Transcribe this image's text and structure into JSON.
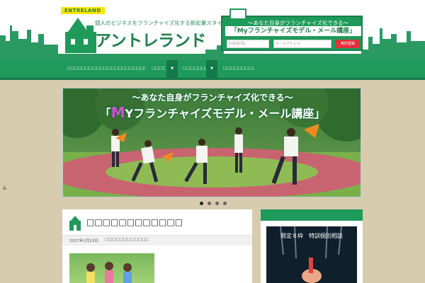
{
  "header": {
    "logo_tag": "ENTRELAND",
    "tagline": "個人のビジネスをフランチャイズ化する新起業スタイル",
    "title": "アントレランド"
  },
  "newsletter": {
    "line1": "～あなた自身がフランチャイズ化できる～",
    "line2": "「Myフランチャイズモデル・メール講座」",
    "name_placeholder": "お名前(姓)",
    "email_placeholder": "メールアドレス",
    "submit_label": "無料登録"
  },
  "nav": {
    "items": [
      {
        "label": "□□□□□□□□□□□□□□□□□□□□□□□□□□"
      },
      {
        "label": "□□□□□"
      },
      {
        "label": "□□□□□□□□"
      },
      {
        "label": "□□□□□□□□□□"
      }
    ],
    "arrow": "▼"
  },
  "banner": {
    "line1": "～あなた自身がフランチャイズ化できる～",
    "line2_open": "「",
    "line2_m": "M",
    "line2_rest": "Yフランチャイズモデル・メール講座」"
  },
  "article": {
    "title": "□□□□□□□□□□□□",
    "date": "2017年1月13日",
    "category": "□□□□□□□□□□□□"
  },
  "sidebar": {
    "ad_text": "限定８枠　特訓個別相談"
  },
  "corner_glyph": "&",
  "colors": {
    "brand_green": "#1e9a5a",
    "dark_green": "#14794a",
    "background": "#d8ccaf",
    "submit_red": "#e4303a"
  }
}
